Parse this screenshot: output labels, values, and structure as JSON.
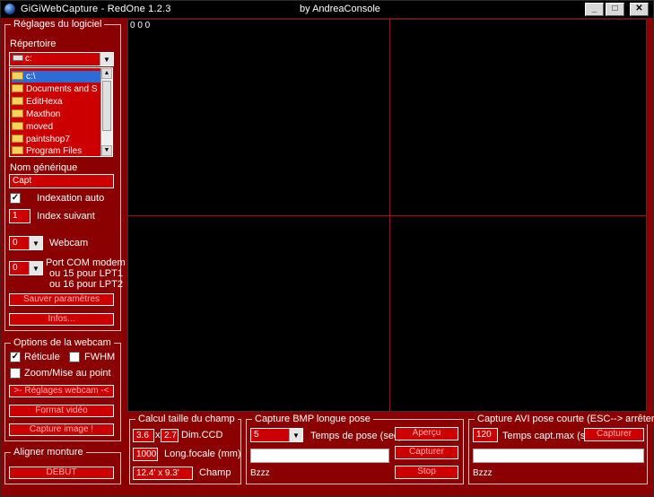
{
  "titlebar": {
    "title": "GiGiWebCapture - RedOne   1.2.3",
    "author": "by AndreaConsole",
    "min_glyph": "_",
    "max_glyph": "□",
    "close_glyph": "✕"
  },
  "settings": {
    "group_title": "Réglages du logiciel",
    "directory_label": "Répertoire",
    "drive_value": "c:",
    "folders": [
      {
        "name": "c:\\",
        "selected": true
      },
      {
        "name": "Documents and S",
        "selected": false
      },
      {
        "name": "EditHexa",
        "selected": false
      },
      {
        "name": "Maxthon",
        "selected": false
      },
      {
        "name": "moved",
        "selected": false
      },
      {
        "name": "paintshop7",
        "selected": false
      },
      {
        "name": "Program Files",
        "selected": false
      }
    ],
    "generic_name_label": "Nom générique",
    "generic_name_value": "Capt",
    "auto_index_label": "Indexation auto",
    "auto_index_checked": true,
    "next_index_label": "Index suivant",
    "next_index_value": "1",
    "webcam_label": "Webcam",
    "webcam_value": "0",
    "port_value": "0",
    "port_label_1": "Port COM modem",
    "port_label_2": "ou 15 pour LPT1",
    "port_label_3": "ou 16 pour LPT2",
    "save_button": "Sauver paramètres",
    "info_button": "Infos..."
  },
  "webcam_options": {
    "group_title": "Options de la webcam",
    "reticle_label": "Réticule",
    "reticle_checked": true,
    "fwhm_label": "FWHM",
    "fwhm_checked": false,
    "zoom_label": "Zoom/Mise au point",
    "zoom_checked": false,
    "settings_button": ">- Réglages webcam -<",
    "format_button": "Format vidéo",
    "capture_button": "Capture image !"
  },
  "mount": {
    "group_title": "Aligner monture",
    "start_button": "DEBUT"
  },
  "viewer": {
    "counter": "0 0 0"
  },
  "field_calc": {
    "group_title": "Calcul taille du champ",
    "ccd_w": "3.6",
    "times": "x",
    "ccd_h": "2.7",
    "ccd_label": "Dim.CCD",
    "focal_value": "1000",
    "focal_label": "Long.focale  (mm)",
    "field_value": "12.4' x 9.3'",
    "field_label": "Champ"
  },
  "bmp_capture": {
    "group_title": "Capture BMP longue pose",
    "exposure_value": "5",
    "exposure_label": "Temps de pose (sec)",
    "preview_button": "Aperçu",
    "capture_button": "Capturer",
    "stop_button": "Stop",
    "status": "Bzzz"
  },
  "avi_capture": {
    "group_title": "Capture AVI pose courte   (ESC--> arrêter)",
    "max_time_value": "120",
    "max_time_label": "Temps capt.max (s)",
    "capture_button": "Capturer",
    "status": "Bzzz"
  }
}
